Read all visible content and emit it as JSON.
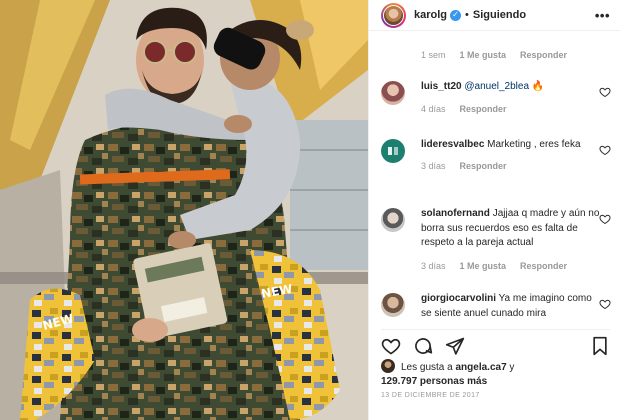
{
  "header": {
    "username": "karolg",
    "verified_icon": "verified-badge-icon",
    "separator": "•",
    "follow_status": "Siguiendo",
    "more_label": "•••"
  },
  "caption_meta": {
    "time": "1 sem",
    "likes": "1 Me gusta",
    "reply": "Responder"
  },
  "comments": [
    {
      "username": "luis_tt20",
      "mention": "@anuel_2blea",
      "text": "",
      "emoji": "🔥",
      "time": "4 días",
      "likes": "",
      "reply": "Responder"
    },
    {
      "username": "lideresvalbec",
      "mention": "",
      "text": "Marketing , eres feka",
      "emoji": "",
      "time": "3 días",
      "likes": "",
      "reply": "Responder"
    },
    {
      "username": "solanofernand",
      "mention": "",
      "text": "Jajjaa q madre y aún no borra sus recuerdos eso es falta de respeto a la pareja actual",
      "emoji": "",
      "time": "3 días",
      "likes": "1 Me gusta",
      "reply": "Responder"
    },
    {
      "username": "giorgiocarvolini",
      "mention": "",
      "text": "Ya me imagino como se siente anuel cunado mira",
      "emoji": "",
      "time": "",
      "likes": "",
      "reply": ""
    }
  ],
  "actions": {
    "like_icon": "heart-icon",
    "comment_icon": "comment-icon",
    "share_icon": "share-icon",
    "save_icon": "bookmark-icon"
  },
  "likes_summary": {
    "prefix": "Les gusta a ",
    "user": "angela.ca7",
    "connector": " y",
    "count": "129.797 personas más"
  },
  "post_date": "13 DE DICIEMBRE DE 2017",
  "colors": {
    "accent_blue": "#3897f0",
    "mention_blue": "#003569",
    "meta_gray": "#999999",
    "heart_red": "#ed4956"
  }
}
